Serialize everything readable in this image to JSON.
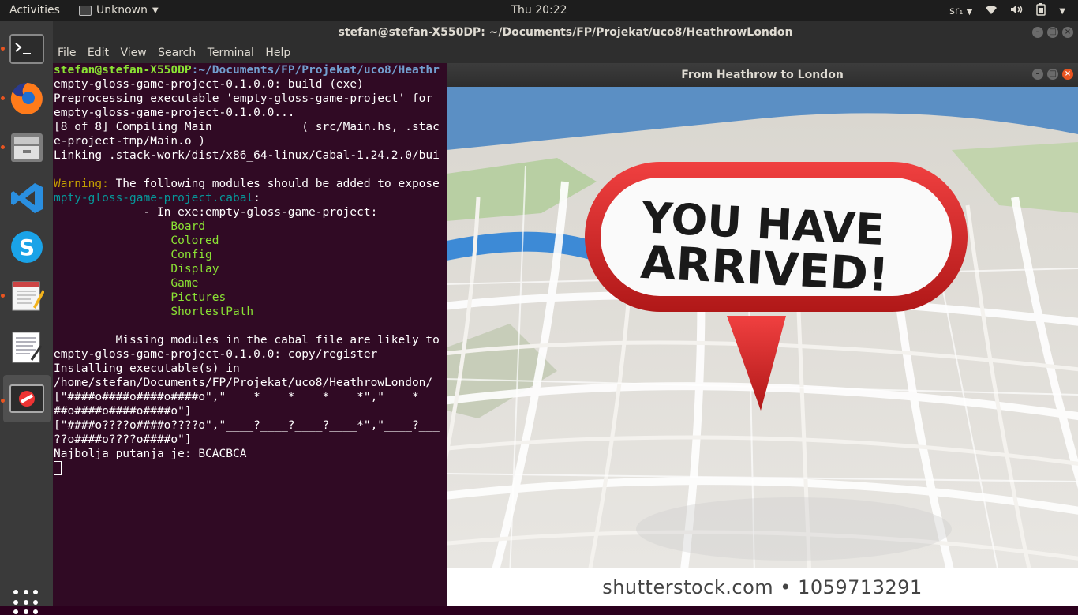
{
  "topbar": {
    "activities": "Activities",
    "app_menu": "Unknown",
    "clock": "Thu 20:22",
    "keyboard": "sr₁"
  },
  "dock": {
    "items": [
      {
        "name": "terminal",
        "icon": "terminal-icon"
      },
      {
        "name": "firefox",
        "icon": "firefox-icon"
      },
      {
        "name": "files",
        "icon": "files-icon"
      },
      {
        "name": "vscode",
        "icon": "vscode-icon"
      },
      {
        "name": "skype",
        "icon": "skype-icon"
      },
      {
        "name": "text-editor",
        "icon": "text-editor-icon"
      },
      {
        "name": "document-viewer",
        "icon": "document-viewer-icon"
      },
      {
        "name": "unknown-app",
        "icon": "no-entry-icon"
      }
    ]
  },
  "terminal": {
    "title": "stefan@stefan-X550DP: ~/Documents/FP/Projekat/uco8/HeathrowLondon",
    "menu": [
      "File",
      "Edit",
      "View",
      "Search",
      "Terminal",
      "Help"
    ],
    "prompt_user": "stefan@stefan-X550DP",
    "prompt_path": ":~/Documents/FP/Projekat/uco8/Heathr",
    "lines": [
      "empty-gloss-game-project-0.1.0.0: build (exe)",
      "Preprocessing executable 'empty-gloss-game-project' for",
      "empty-gloss-game-project-0.1.0.0...",
      "[8 of 8] Compiling Main             ( src/Main.hs, .stac",
      "e-project-tmp/Main.o )",
      "Linking .stack-work/dist/x86_64-linux/Cabal-1.24.2.0/bui",
      "",
      "The following modules should be added to expose",
      "mpty-gloss-game-project.cabal",
      "             - In exe:empty-gloss-game-project:",
      "Board",
      "Colored",
      "Config",
      "Display",
      "Game",
      "Pictures",
      "ShortestPath",
      "",
      "         Missing modules in the cabal file are likely to",
      "empty-gloss-game-project-0.1.0.0: copy/register",
      "Installing executable(s) in",
      "/home/stefan/Documents/FP/Projekat/uco8/HeathrowLondon/",
      "[\"####o####o####o####o\",\"____*____*____*____*\",\"____*___",
      "##o####o####o####o\"]",
      "[\"####o????o####o????o\",\"____?____?____?____*\",\"____?___",
      "??o####o????o####o\"]",
      "Najbolja putanja je: BCACBCA"
    ],
    "warning_label": "Warning:",
    "cabal_colon": ":"
  },
  "image_window": {
    "title": "From Heathrow to London",
    "sign_line1": "YOU HAVE",
    "sign_line2": "ARRIVED!",
    "caption": "shutterstock.com • 1059713291"
  },
  "colors": {
    "terminal_bg": "#300a24",
    "accent": "#e95420",
    "sign_red": "#d92020"
  }
}
